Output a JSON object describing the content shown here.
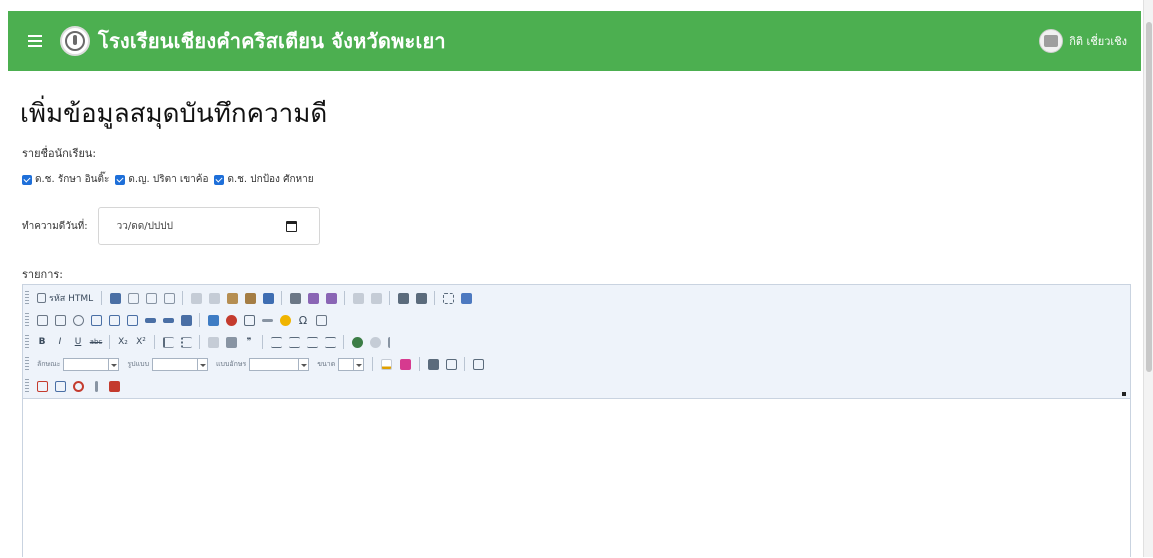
{
  "header": {
    "school_name": "โรงเรียนเชียงคำคริสเตียน จังหวัดพะเยา",
    "user_name": "กิติ เชี่ยวเชิง",
    "menu_icon": "hamburger-icon",
    "accent_color": "#4caf50"
  },
  "page": {
    "title": "เพิ่มข้อมูลสมุดบันทึกความดี",
    "students_label": "รายชื่อนักเรียน:",
    "students": [
      {
        "name": "ด.ช. รักษา อินติ๊ะ",
        "checked": true
      },
      {
        "name": "ด.ญ. ปริตา เขาค้อ",
        "checked": true
      },
      {
        "name": "ด.ช. ปกป้อง ศักหาย",
        "checked": true
      }
    ],
    "date_label": "ทำความดีวันที่:",
    "date_placeholder": "วว/ดด/ปปปป",
    "details_label": "รายการ:"
  },
  "editor": {
    "source_label": "รหัส HTML",
    "font_label": "ลักษณะ",
    "format_label": "รูปแบบ",
    "family_label": "แบบอักษร",
    "size_label": "ขนาด",
    "bold": "B",
    "italic": "I",
    "underline": "U",
    "strike": "abc",
    "subscript": "X₂",
    "superscript": "X²",
    "quote": "❞"
  }
}
